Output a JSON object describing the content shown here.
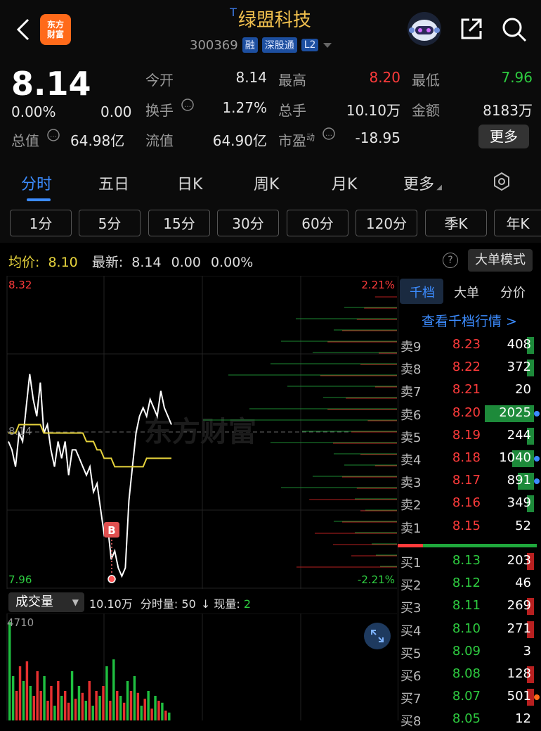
{
  "header": {
    "back_icon": "chevron-left-icon",
    "logo_line1": "东方",
    "logo_line2": "财富",
    "stock_name": "绿盟科技",
    "t_mark": "T",
    "stock_code": "300369",
    "tags": [
      "融",
      "深股通",
      "L2"
    ],
    "colors": {
      "title": "#f2c14e",
      "logo": "#ff6a1a",
      "tag": "#1d4fa0"
    }
  },
  "quote": {
    "price": "8.14",
    "change_pct": "0.00%",
    "change": "0.00",
    "market_cap_label": "总值",
    "market_cap": "64.98亿",
    "open_label": "今开",
    "open": "8.14",
    "high_label": "最高",
    "high": "8.20",
    "low_label": "最低",
    "low": "7.96",
    "turnover_label": "换手",
    "turnover": "1.27%",
    "total_hands_label": "总手",
    "total_hands": "10.10万",
    "amount_label": "金额",
    "amount": "8183万",
    "float_cap_label": "流值",
    "float_cap": "64.90亿",
    "pe_label": "市盈",
    "pe_sup": "动",
    "pe": "-18.95",
    "more": "更多"
  },
  "tabs": [
    "分时",
    "五日",
    "日K",
    "周K",
    "月K",
    "更多"
  ],
  "intervals": [
    "1分",
    "5分",
    "15分",
    "30分",
    "60分",
    "120分",
    "季K",
    "年K"
  ],
  "avg_row": {
    "avg_label": "均价:",
    "avg": "8.10",
    "latest_label": "最新:",
    "latest": "8.14",
    "chg": "0.00",
    "chg_pct": "0.00%",
    "mode_button": "大单模式"
  },
  "chart_data": {
    "type": "line",
    "y_top": "8.32",
    "y_bottom": "7.96",
    "y_mid": "8.14",
    "pct_top": "2.21%",
    "pct_bottom": "-2.21%",
    "ylim": [
      7.96,
      8.32
    ],
    "watermark": "东方财富",
    "marker": "B",
    "series": [
      {
        "name": "price",
        "values": [
          8.13,
          8.12,
          8.1,
          8.14,
          8.13,
          8.17,
          8.21,
          8.18,
          8.16,
          8.2,
          8.14,
          8.15,
          8.12,
          8.1,
          8.13,
          8.11,
          8.13,
          8.09,
          8.12,
          8.12,
          8.11,
          8.1,
          8.09,
          8.1,
          8.07,
          8.08,
          8.05,
          8.02,
          8.03,
          7.99,
          8.0,
          7.98,
          7.97,
          7.98,
          8.06,
          8.1,
          8.14,
          8.16,
          8.17,
          8.16,
          8.18,
          8.17,
          8.16,
          8.19,
          8.17,
          8.16,
          8.15
        ],
        "color": "#ffffff"
      },
      {
        "name": "avg",
        "values": [
          8.14,
          8.14,
          8.14,
          8.15,
          8.15,
          8.15,
          8.15,
          8.15,
          8.15,
          8.15,
          8.14,
          8.14,
          8.14,
          8.14,
          8.14,
          8.14,
          8.14,
          8.14,
          8.14,
          8.14,
          8.14,
          8.14,
          8.13,
          8.13,
          8.13,
          8.12,
          8.12,
          8.11,
          8.11,
          8.11,
          8.1,
          8.1,
          8.1,
          8.1,
          8.1,
          8.1,
          8.1,
          8.1,
          8.1,
          8.11,
          8.11,
          8.11,
          8.11,
          8.11,
          8.11,
          8.11,
          8.11
        ],
        "color": "#e6d33c"
      }
    ]
  },
  "depth_bars": {
    "red": [
      0.12,
      0.18,
      0.22,
      0.3,
      0.38,
      0.1,
      0.2,
      0.42,
      0.12,
      0.28,
      0.38,
      0.16,
      0.25,
      0.35,
      0.2,
      0.12,
      0.3,
      0.22,
      0.48,
      0.2,
      0.3,
      0.45,
      0.35,
      0.25,
      0.55
    ],
    "green": [
      0.25,
      0.48,
      0.3,
      0.55,
      0.4,
      0.6,
      0.8,
      0.52,
      0.35,
      0.7,
      0.92,
      0.45,
      0.6,
      0.3,
      0.25,
      0.4,
      0.55,
      0.2,
      0.15,
      0.3,
      0.2,
      0.12,
      0.1,
      0.08
    ]
  },
  "volume": {
    "select": "成交量",
    "total": "10.10万",
    "fs_label": "分时量:",
    "fs_value": "50",
    "now_label": "现量:",
    "now_value": "2",
    "max_label": "4710",
    "bars": [
      {
        "v": 1.0,
        "c": "g"
      },
      {
        "v": 0.45,
        "c": "g"
      },
      {
        "v": 0.3,
        "c": "r"
      },
      {
        "v": 0.55,
        "c": "r"
      },
      {
        "v": 0.4,
        "c": "g"
      },
      {
        "v": 0.6,
        "c": "r"
      },
      {
        "v": 0.35,
        "c": "g"
      },
      {
        "v": 0.25,
        "c": "r"
      },
      {
        "v": 0.5,
        "c": "r"
      },
      {
        "v": 0.3,
        "c": "r"
      },
      {
        "v": 0.45,
        "c": "g"
      },
      {
        "v": 0.2,
        "c": "r"
      },
      {
        "v": 0.35,
        "c": "r"
      },
      {
        "v": 0.15,
        "c": "g"
      },
      {
        "v": 0.4,
        "c": "r"
      },
      {
        "v": 0.25,
        "c": "g"
      },
      {
        "v": 0.3,
        "c": "r"
      },
      {
        "v": 0.18,
        "c": "r"
      },
      {
        "v": 0.5,
        "c": "g"
      },
      {
        "v": 0.22,
        "c": "r"
      },
      {
        "v": 0.35,
        "c": "g"
      },
      {
        "v": 0.28,
        "c": "r"
      },
      {
        "v": 0.2,
        "c": "g"
      },
      {
        "v": 0.4,
        "c": "r"
      },
      {
        "v": 0.15,
        "c": "g"
      },
      {
        "v": 0.3,
        "c": "r"
      },
      {
        "v": 0.25,
        "c": "g"
      },
      {
        "v": 0.35,
        "c": "r"
      },
      {
        "v": 0.55,
        "c": "g"
      },
      {
        "v": 0.2,
        "c": "r"
      },
      {
        "v": 0.62,
        "c": "g"
      },
      {
        "v": 0.3,
        "c": "r"
      },
      {
        "v": 0.25,
        "c": "g"
      },
      {
        "v": 0.18,
        "c": "r"
      },
      {
        "v": 0.4,
        "c": "g"
      },
      {
        "v": 0.3,
        "c": "r"
      },
      {
        "v": 0.45,
        "c": "g"
      },
      {
        "v": 0.28,
        "c": "r"
      },
      {
        "v": 0.15,
        "c": "g"
      },
      {
        "v": 0.22,
        "c": "r"
      },
      {
        "v": 0.3,
        "c": "g"
      },
      {
        "v": 0.12,
        "c": "r"
      },
      {
        "v": 0.25,
        "c": "g"
      },
      {
        "v": 0.2,
        "c": "r"
      },
      {
        "v": 0.18,
        "c": "g"
      },
      {
        "v": 0.1,
        "c": "r"
      },
      {
        "v": 0.08,
        "c": "g"
      }
    ]
  },
  "book": {
    "tabs": [
      "千档",
      "大单",
      "分价"
    ],
    "view_link": "查看千档行情 >",
    "asks": [
      {
        "label": "卖9",
        "price": "8.23",
        "vol": "408",
        "bar": 0.05
      },
      {
        "label": "卖8",
        "price": "8.22",
        "vol": "372",
        "bar": 0.05
      },
      {
        "label": "卖7",
        "price": "8.21",
        "vol": "20",
        "bar": 0
      },
      {
        "label": "卖6",
        "price": "8.20",
        "vol": "2025",
        "bar": 0.9,
        "dot": "#3c8cff"
      },
      {
        "label": "卖5",
        "price": "8.19",
        "vol": "244",
        "bar": 0.03
      },
      {
        "label": "卖4",
        "price": "8.18",
        "vol": "1040",
        "bar": 0.4,
        "dot": "#3c8cff"
      },
      {
        "label": "卖3",
        "price": "8.17",
        "vol": "891",
        "bar": 0.3,
        "dot": "#3c8cff"
      },
      {
        "label": "卖2",
        "price": "8.16",
        "vol": "349",
        "bar": 0.05
      },
      {
        "label": "卖1",
        "price": "8.15",
        "vol": "52",
        "bar": 0
      }
    ],
    "bids": [
      {
        "label": "买1",
        "price": "8.13",
        "vol": "203",
        "bar": 0.05,
        "barc": "red"
      },
      {
        "label": "买2",
        "price": "8.12",
        "vol": "46",
        "bar": 0
      },
      {
        "label": "买3",
        "price": "8.11",
        "vol": "269",
        "bar": 0.05,
        "barc": "red"
      },
      {
        "label": "买4",
        "price": "8.10",
        "vol": "271",
        "bar": 0.05,
        "barc": "red"
      },
      {
        "label": "买5",
        "price": "8.09",
        "vol": "3",
        "bar": 0
      },
      {
        "label": "买6",
        "price": "8.08",
        "vol": "128",
        "bar": 0.03,
        "barc": "red"
      },
      {
        "label": "买7",
        "price": "8.07",
        "vol": "501",
        "bar": 0.06,
        "barc": "red",
        "dot": "#ff6a1a"
      },
      {
        "label": "买8",
        "price": "8.05",
        "vol": "12",
        "bar": 0
      }
    ]
  }
}
